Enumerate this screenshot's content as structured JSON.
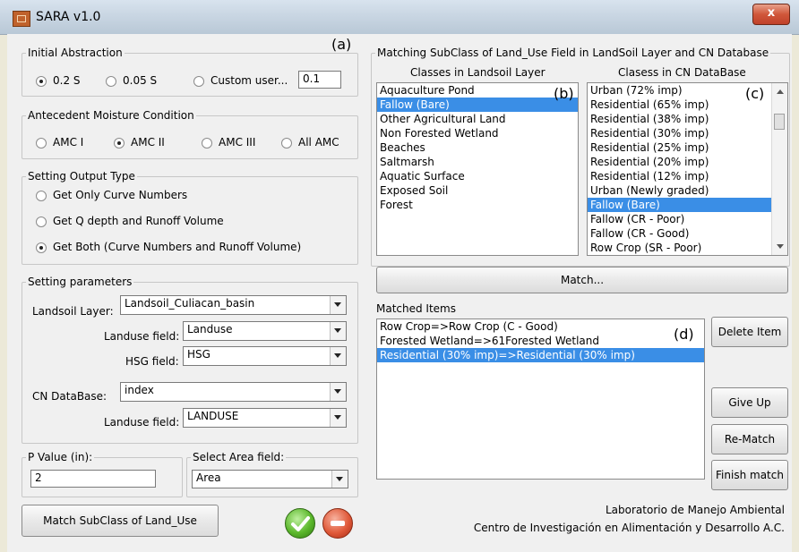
{
  "window": {
    "title": "SARA v1.0",
    "close": "x"
  },
  "tags": {
    "a": "(a)",
    "b": "(b)",
    "c": "(c)",
    "d": "(d)"
  },
  "initial_abstraction": {
    "legend": "Initial Abstraction",
    "options": [
      "0.2 S",
      "0.05 S",
      "Custom user..."
    ],
    "selected": "0.2 S",
    "custom_value": "0.1"
  },
  "amc": {
    "legend": "Antecedent Moisture Condition",
    "options": [
      "AMC I",
      "AMC II",
      "AMC III",
      "All AMC"
    ],
    "selected": "AMC II"
  },
  "output_type": {
    "legend": "Setting Output Type",
    "options": [
      "Get Only Curve Numbers",
      "Get Q depth and Runoff Volume",
      "Get Both (Curve Numbers and Runoff Volume)"
    ],
    "selected": "Get Both (Curve Numbers and Runoff Volume)"
  },
  "parameters": {
    "legend": "Setting parameters",
    "landsoil_layer_label": "Landsoil Layer:",
    "landsoil_layer_value": "Landsoil_Culiacan_basin",
    "landuse_field_label": "Landuse field:",
    "landuse_field_value": "Landuse",
    "hsg_field_label": "HSG field:",
    "hsg_field_value": "HSG",
    "cn_database_label": "CN DataBase:",
    "cn_database_value": "index",
    "cn_landuse_field_label": "Landuse field:",
    "cn_landuse_field_value": "LANDUSE"
  },
  "p_value": {
    "legend": "P Value (in):",
    "value": "2"
  },
  "area_field": {
    "legend": "Select Area field:",
    "value": "Area"
  },
  "buttons": {
    "match_subclass": "Match SubClass of Land_Use",
    "match": "Match...",
    "delete_item": "Delete Item",
    "give_up": "Give Up",
    "re_match": "Re-Match",
    "finish_match": "Finish match"
  },
  "matching": {
    "legend": "Matching SubClass of Land_Use Field in LandSoil Layer and CN Database",
    "left_header": "Classes in Landsoil Layer",
    "right_header": "Clasess in CN DataBase",
    "left_items": [
      "Aquaculture Pond",
      "Fallow (Bare)",
      "Other Agricultural Land",
      "Non Forested Wetland",
      "Beaches",
      "Saltmarsh",
      "Aquatic Surface",
      "Exposed Soil",
      "Forest"
    ],
    "left_selected": 1,
    "right_items": [
      "Urban (72% imp)",
      "Residential (65% imp)",
      "Residential (38% imp)",
      "Residential (30% imp)",
      "Residential (25% imp)",
      "Residential (20% imp)",
      "Residential (12% imp)",
      "Urban (Newly graded)",
      "Fallow (Bare)",
      "Fallow (CR - Poor)",
      "Fallow (CR - Good)",
      "Row Crop (SR - Poor)"
    ],
    "right_selected": 8
  },
  "matched": {
    "label": "Matched Items",
    "items": [
      "Row Crop=>Row Crop (C - Good)",
      "Forested  Wetland=>61Forested Wetland",
      "Residential (30% imp)=>Residential (30% imp)"
    ],
    "selected": 2
  },
  "credits": {
    "line1": "Laboratorio de Manejo Ambiental",
    "line2": "Centro de Investigación en Alimentación y Desarrollo A.C."
  }
}
